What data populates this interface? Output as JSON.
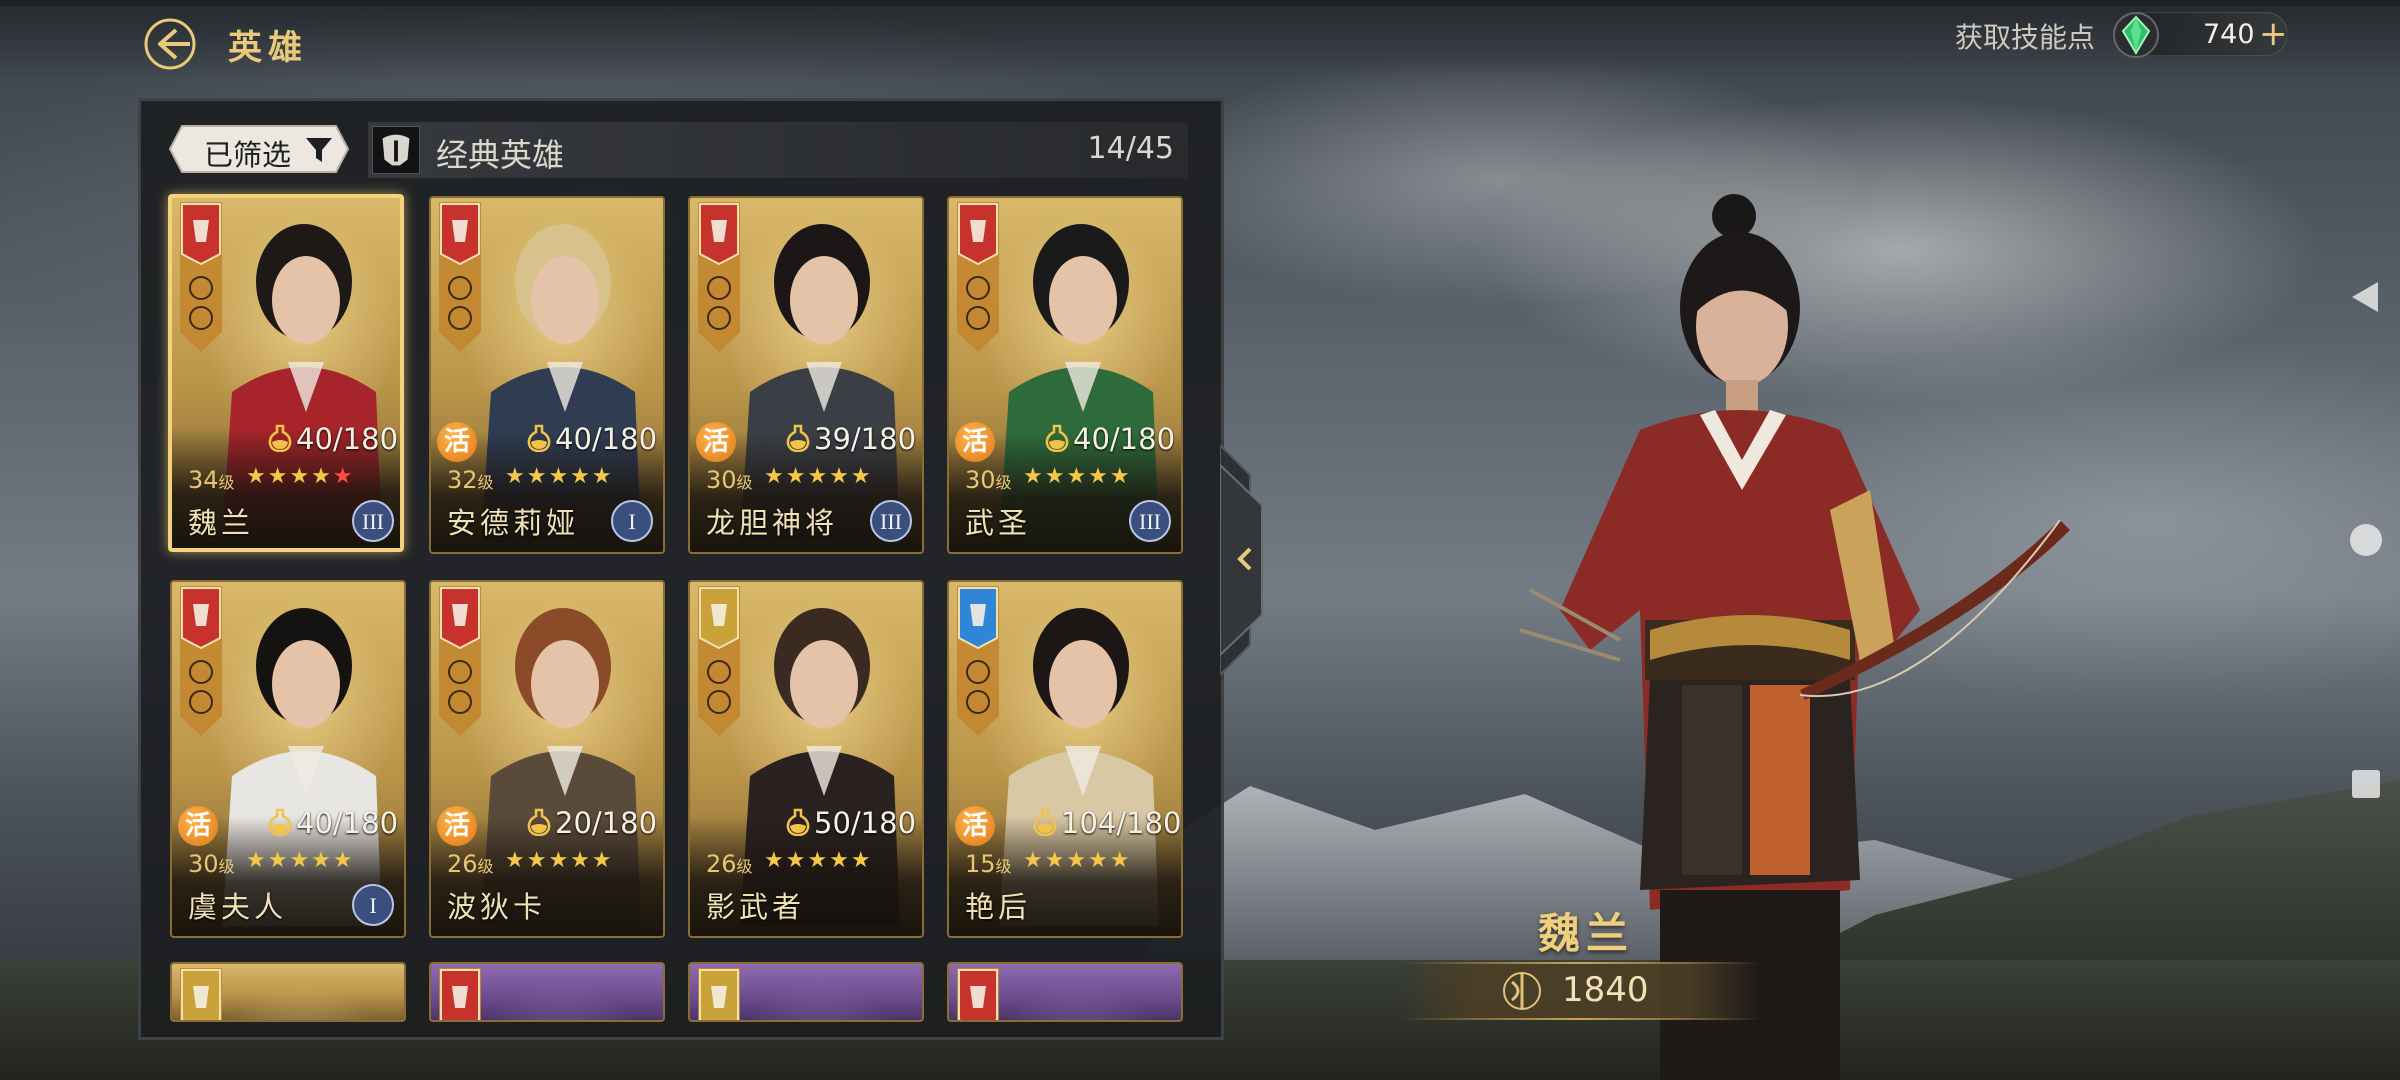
{
  "header": {
    "title": "英雄",
    "back_icon": "back-arrow-icon"
  },
  "skill_points": {
    "label": "获取技能点",
    "value": "740",
    "add_label": "+",
    "icon": "emerald-gem-icon"
  },
  "filter": {
    "label": "已筛选",
    "icon": "funnel-icon"
  },
  "category": {
    "label": "经典英雄",
    "count": "14/45",
    "icon": "helmet-icon"
  },
  "heroes": [
    {
      "name": "魏兰",
      "level": "34",
      "level_unit": "级",
      "stars_gold": "★★★★",
      "stars_red": "★",
      "fragments": "40/180",
      "tier": "III",
      "active": "",
      "selected": true,
      "faction_color": "#c8322c"
    },
    {
      "name": "安德莉娅",
      "level": "32",
      "level_unit": "级",
      "stars_gold": "★★★★★",
      "stars_red": "",
      "fragments": "40/180",
      "tier": "I",
      "active": "活",
      "selected": false,
      "faction_color": "#c8322c"
    },
    {
      "name": "龙胆神将",
      "level": "30",
      "level_unit": "级",
      "stars_gold": "★★★★★",
      "stars_red": "",
      "fragments": "39/180",
      "tier": "III",
      "active": "活",
      "selected": false,
      "faction_color": "#c8322c"
    },
    {
      "name": "武圣",
      "level": "30",
      "level_unit": "级",
      "stars_gold": "★★★★★",
      "stars_red": "",
      "fragments": "40/180",
      "tier": "III",
      "active": "活",
      "selected": false,
      "faction_color": "#c8322c"
    },
    {
      "name": "虞夫人",
      "level": "30",
      "level_unit": "级",
      "stars_gold": "★★★★★",
      "stars_red": "",
      "fragments": "40/180",
      "tier": "I",
      "active": "活",
      "selected": false,
      "faction_color": "#c8322c"
    },
    {
      "name": "波狄卡",
      "level": "26",
      "level_unit": "级",
      "stars_gold": "★★★★★",
      "stars_red": "",
      "fragments": "20/180",
      "tier": "",
      "active": "活",
      "selected": false,
      "faction_color": "#c8322c"
    },
    {
      "name": "影武者",
      "level": "26",
      "level_unit": "级",
      "stars_gold": "★★★★★",
      "stars_red": "",
      "fragments": "50/180",
      "tier": "",
      "active": "",
      "selected": false,
      "faction_color": "#c9a23a"
    },
    {
      "name": "艳后",
      "level": "15",
      "level_unit": "级",
      "stars_gold": "★★★★★",
      "stars_red": "",
      "fragments": "104/180",
      "tier": "",
      "active": "活",
      "selected": false,
      "faction_color": "#2f86d6"
    }
  ],
  "partial_cards": [
    {
      "faction_color": "#c9a23a",
      "style": "gold"
    },
    {
      "faction_color": "#c8322c",
      "style": "purple"
    },
    {
      "faction_color": "#c9a23a",
      "style": "purple"
    },
    {
      "faction_color": "#c8322c",
      "style": "purple"
    }
  ],
  "selected_hero": {
    "name": "魏兰",
    "power": "1840",
    "power_icon": "bow-power-icon"
  },
  "panel_toggle": {
    "icon": "chevron-left-icon"
  }
}
